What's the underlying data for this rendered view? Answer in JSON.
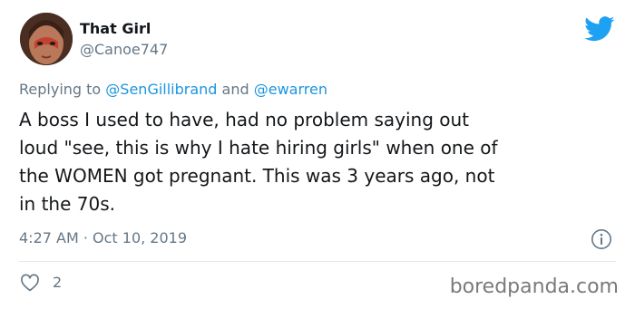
{
  "author": {
    "display_name": "That Girl",
    "handle": "@Canoe747",
    "avatar_icon": "profile-photo"
  },
  "reply": {
    "prefix": "Replying to ",
    "mention_1": "@SenGillibrand",
    "connector": " and ",
    "mention_2": "@ewarren"
  },
  "tweet": {
    "text": "A boss I used to have, had no problem saying out\nloud \"see, this is why I hate hiring girls\" when one of\nthe WOMEN got pregnant. This was 3 years ago, not\nin the 70s.",
    "timestamp": "4:27 AM · Oct 10, 2019"
  },
  "engagement": {
    "like_count": "2"
  },
  "watermark": "boredpanda.com",
  "colors": {
    "twitter_blue": "#1DA1F2",
    "mention_blue": "#1B95E0",
    "secondary_text": "#657786",
    "primary_text": "#14171A",
    "divider": "#E1E8ED"
  },
  "icons": {
    "brand": "twitter-bird-icon",
    "info": "info-icon",
    "like": "heart-icon"
  }
}
